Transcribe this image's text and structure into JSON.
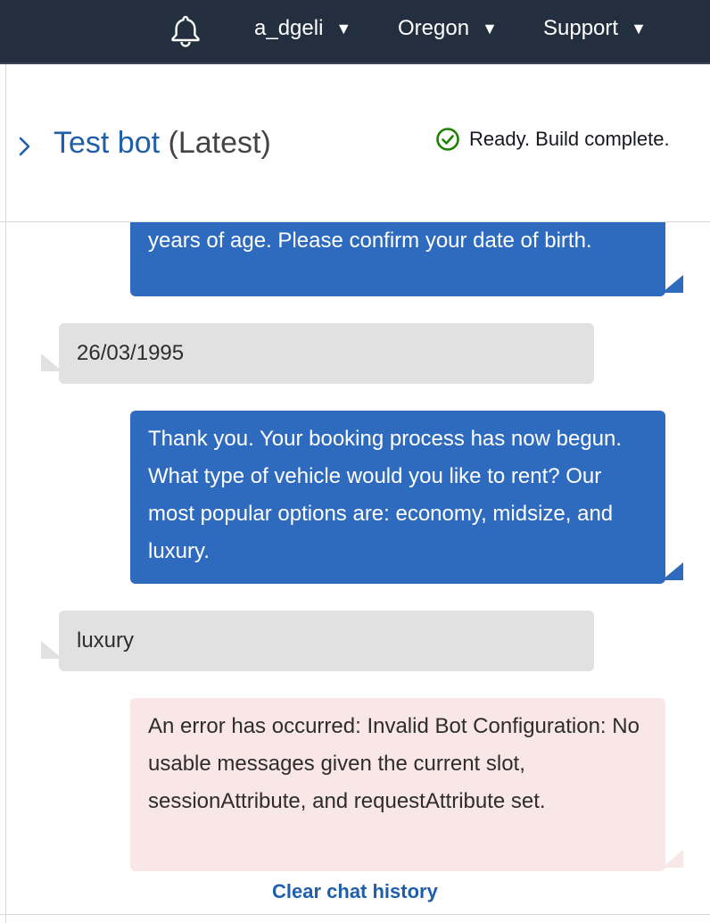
{
  "topnav": {
    "bell_icon": "bell-icon",
    "user": "a_dgeli",
    "region": "Oregon",
    "support": "Support",
    "caret": "▼"
  },
  "panel": {
    "expand_icon": "chevron-right-icon",
    "title_link": "Test bot",
    "title_suffix": "(Latest)",
    "status_icon": "check-circle-icon",
    "status_text": "Ready. Build complete."
  },
  "messages": [
    {
      "from": "bot",
      "text": "years of age. Please confirm your date of birth."
    },
    {
      "from": "user",
      "text": "26/03/1995"
    },
    {
      "from": "bot",
      "text": "Thank you. Your booking process has now begun. What type of vehicle would you like to rent? Our most popular options are: economy, midsize, and luxury."
    },
    {
      "from": "user",
      "text": "luxury"
    },
    {
      "from": "error",
      "text": "An error has occurred: Invalid Bot Configuration: No usable messages given the current slot, sessionAttribute, and requestAttribute set."
    }
  ],
  "footer": {
    "clear_history": "Clear chat history"
  },
  "colors": {
    "nav_bg": "#232f3e",
    "bot_bubble": "#2e6bbf",
    "user_bubble": "#e1e1e1",
    "error_bubble": "#f9e6e6",
    "link": "#1f5ea8",
    "success": "#1d8102"
  }
}
